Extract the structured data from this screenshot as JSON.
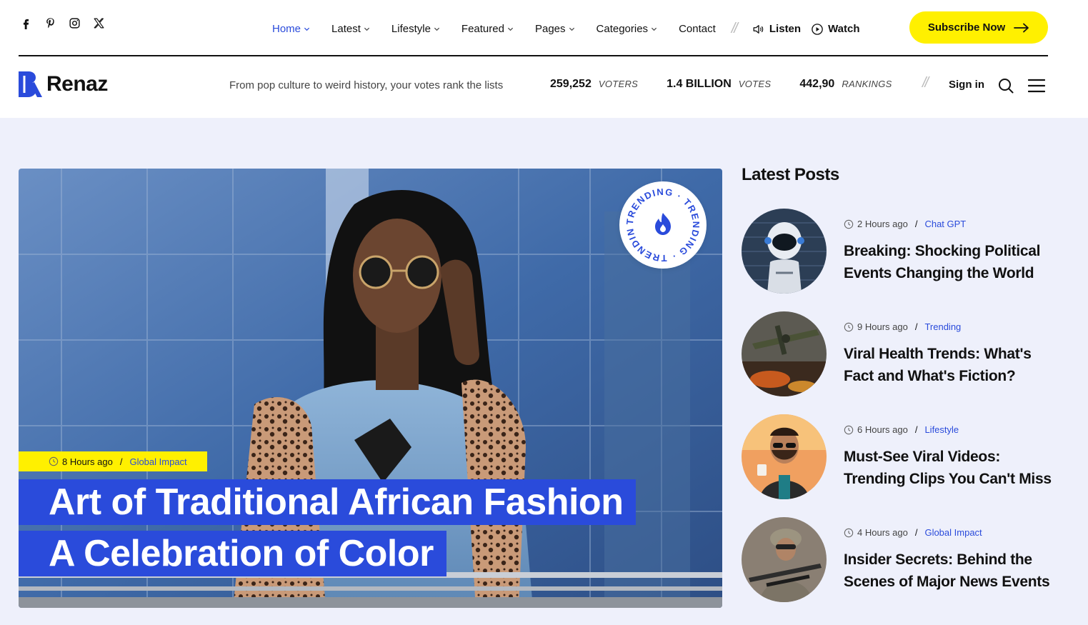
{
  "socials": [
    {
      "icon": "facebook-icon"
    },
    {
      "icon": "pinterest-icon"
    },
    {
      "icon": "instagram-icon"
    },
    {
      "icon": "x-twitter-icon"
    }
  ],
  "nav": {
    "items": [
      {
        "label": "Home",
        "active": true,
        "dropdown": true
      },
      {
        "label": "Latest",
        "dropdown": true
      },
      {
        "label": "Lifestyle",
        "dropdown": true
      },
      {
        "label": "Featured",
        "dropdown": true
      },
      {
        "label": "Pages",
        "dropdown": true
      },
      {
        "label": "Categories",
        "dropdown": true
      },
      {
        "label": "Contact",
        "dropdown": false
      }
    ],
    "separator": "//",
    "listen_label": "Listen",
    "watch_label": "Watch",
    "subscribe_label": "Subscribe Now"
  },
  "brand": {
    "name": "Renaz",
    "tagline": "From pop culture to weird history, your votes rank the lists"
  },
  "stats": [
    {
      "value": "259,252",
      "label": "VOTERS"
    },
    {
      "value": "1.4 BILLION",
      "label": "VOTES"
    },
    {
      "value": "442,90",
      "label": "RANKINGS"
    }
  ],
  "header": {
    "separator": "//",
    "signin_label": "Sign in"
  },
  "hero": {
    "time": "8 Hours ago",
    "separator": "/",
    "category": "Global Impact",
    "title_line1": "Art of Traditional African Fashion",
    "title_line2": "A Celebration of Color",
    "badge_text": "TRENDING · TRENDING · TRENDING ·"
  },
  "latest": {
    "title": "Latest Posts",
    "separator": "/",
    "posts": [
      {
        "time": "2 Hours ago",
        "category": "Chat GPT",
        "title": "Breaking: Shocking Political Events Changing the World"
      },
      {
        "time": "9 Hours ago",
        "category": "Trending",
        "title": "Viral Health Trends: What's Fact and What's Fiction?"
      },
      {
        "time": "6 Hours ago",
        "category": "Lifestyle",
        "title": "Must-See Viral Videos: Trending Clips You Can't Miss"
      },
      {
        "time": "4 Hours ago",
        "category": "Global Impact",
        "title": "Insider Secrets: Behind the Scenes of Major News Events"
      }
    ]
  },
  "colors": {
    "accent_blue": "#2a4bdb",
    "accent_yellow": "#fff000",
    "content_bg": "#eef0fb"
  }
}
